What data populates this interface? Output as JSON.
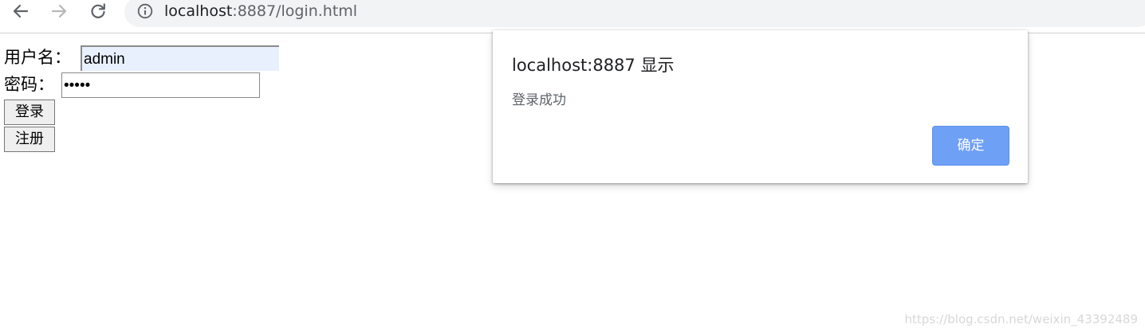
{
  "browser": {
    "back_icon": "arrow-left-icon",
    "forward_icon": "arrow-right-icon",
    "reload_icon": "reload-icon",
    "site_info_icon": "info-icon",
    "url_host": "localhost",
    "url_rest": ":8887/login.html"
  },
  "login_form": {
    "username_label": "用户名：",
    "username_value": "admin",
    "password_label": "密码：",
    "password_value": "•••••",
    "login_button": "登录",
    "register_button": "注册"
  },
  "alert": {
    "title": "localhost:8887 显示",
    "message": "登录成功",
    "ok_button": "确定",
    "ok_color": "#6ea0f6"
  },
  "watermark": "https://blog.csdn.net/weixin_43392489"
}
